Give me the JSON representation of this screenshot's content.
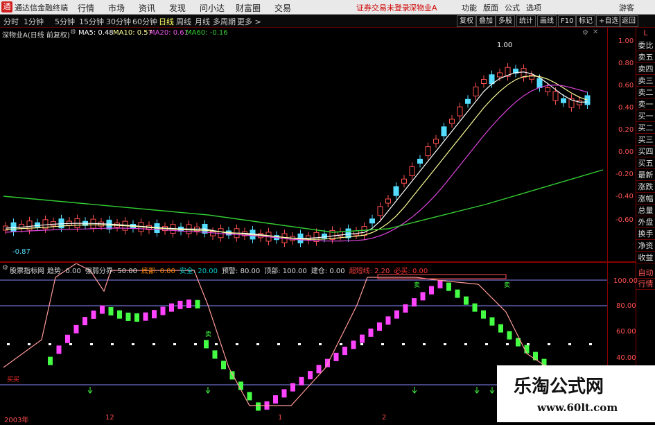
{
  "titlebar": {
    "app_title": "通达信金融终端",
    "menus": [
      "行情",
      "市场",
      "资讯",
      "发现",
      "问小达",
      "财富圈",
      "交易"
    ],
    "broker_status": "证券交易未登录",
    "stock_name": "深物业A",
    "right_menus": [
      "功能",
      "版面",
      "公式",
      "选项"
    ],
    "guest": "游客"
  },
  "toolbar": {
    "periods": [
      "分时",
      "1分钟",
      "5分钟",
      "15分钟",
      "30分钟",
      "60分钟",
      "日线",
      "周线",
      "月线",
      "多周期",
      "更多 >"
    ],
    "active_period": "日线",
    "buttons": [
      "复权",
      "叠加",
      "多股",
      "统计",
      "画线",
      "F10",
      "标记",
      "+自选",
      "返回"
    ]
  },
  "main_chart": {
    "header": {
      "stock": "深物业A(日线 前复权)",
      "ma5": "MA5: 0.48",
      "ma10": "MA10: 0.57",
      "ma20": "MA20: 0.61",
      "ma60": "MA60: -0.16"
    },
    "y_labels": [
      "1.00",
      "0.80",
      "0.60",
      "0.40",
      "0.20",
      "0.00",
      "-0.20",
      "-0.40",
      "-0.60"
    ],
    "max_label": "1.00",
    "min_label": "-0.87"
  },
  "indicator": {
    "name": "股票指标网",
    "params": [
      {
        "label": "趋势: 0.00",
        "color": "#dddddd"
      },
      {
        "label": "强弱分界: 50.00",
        "color": "#dddddd"
      },
      {
        "label": "底部: 0.00",
        "color": "#ff8800"
      },
      {
        "label": "安全: 20.00",
        "color": "#00cccc"
      },
      {
        "label": "预警: 80.00",
        "color": "#dddddd"
      },
      {
        "label": "顶部: 100.00",
        "color": "#dddddd"
      },
      {
        "label": "建仓: 0.00",
        "color": "#dddddd"
      },
      {
        "label": "超短线: 2.20",
        "color": "#ff4040"
      },
      {
        "label": "必买: 0.00",
        "color": "#ff3030"
      }
    ],
    "y_labels": [
      "100.00",
      "80.00",
      "60.00",
      "40.00"
    ],
    "marks": [
      "卖",
      "卖",
      "卖"
    ],
    "bottom_label": "买买"
  },
  "time_axis": [
    "2003年",
    "12",
    "1",
    "2"
  ],
  "right_panel": {
    "top_label": "L",
    "items": [
      "委比",
      "卖五",
      "卖四",
      "卖三",
      "卖二",
      "卖一",
      "买一",
      "买二",
      "买三",
      "买四",
      "买五",
      "最新",
      "涨跌",
      "涨幅",
      "总量",
      "外盘",
      "换手",
      "净资",
      "收益"
    ],
    "bottom_items": [
      "自动",
      "行情"
    ]
  },
  "watermark": {
    "title": "乐淘公式网",
    "url": "www.60lt.com"
  },
  "colors": {
    "up": "#ff5050",
    "down": "#55ddff",
    "ma5": "#ffffff",
    "ma10": "#ffff99",
    "ma20": "#dd44dd",
    "ma60": "#33cc33",
    "buy_bar": "#ff44ff",
    "sell_bar": "#44ff44"
  }
}
